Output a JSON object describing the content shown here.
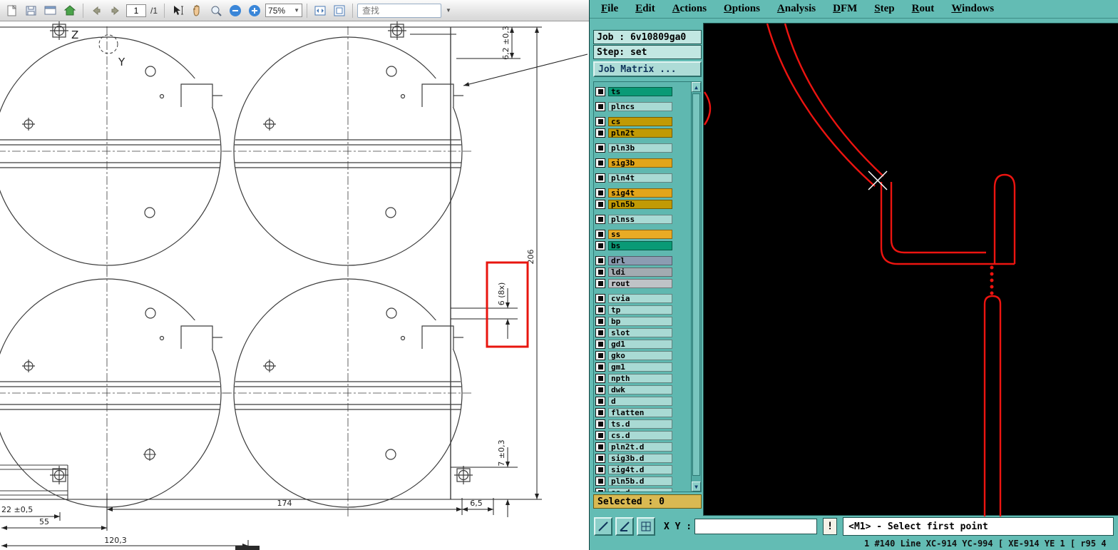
{
  "pdf": {
    "toolbar": {
      "page_current": "1",
      "page_total": "/1",
      "zoom_level": "75%",
      "search_placeholder": "查找"
    },
    "drawing": {
      "highlight_color": "#e8150e",
      "dims": {
        "label_z": "Z",
        "label_y": "Y",
        "gap_top": "6,2 ±0,3",
        "panel_height": "206",
        "tab_width": "6 (8x)",
        "gap_bottom": "7 ±0,3",
        "strip_height": "22 ±0,5",
        "strip_width": "55",
        "pitch": "174",
        "edge_gap": "6,5",
        "offset": "120,3"
      }
    }
  },
  "cam": {
    "menu": [
      "File",
      "Edit",
      "Actions",
      "Options",
      "Analysis",
      "DFM",
      "Step",
      "Rout",
      "Windows"
    ],
    "job_label": "Job : 6v10809ga0",
    "step_label": "Step: set",
    "job_matrix_label": "Job Matrix ...",
    "layers": [
      {
        "name": "ts",
        "color": "#0a9a76",
        "gap": false
      },
      {
        "name": "plncs",
        "color": "#a9dad4",
        "gap": true
      },
      {
        "name": "cs",
        "color": "#c19a04",
        "gap": true
      },
      {
        "name": "pln2t",
        "color": "#c19a04",
        "gap": false
      },
      {
        "name": "pln3b",
        "color": "#a9dad4",
        "gap": true
      },
      {
        "name": "sig3b",
        "color": "#e2a51a",
        "gap": true
      },
      {
        "name": "pln4t",
        "color": "#a9dad4",
        "gap": true
      },
      {
        "name": "sig4t",
        "color": "#e2a51a",
        "gap": true
      },
      {
        "name": "pln5b",
        "color": "#c19a04",
        "gap": false
      },
      {
        "name": "plnss",
        "color": "#a9dad4",
        "gap": true
      },
      {
        "name": "ss",
        "color": "#e9ab25",
        "gap": true
      },
      {
        "name": "bs",
        "color": "#0a9a76",
        "gap": false
      },
      {
        "name": "drl",
        "color": "#8c9cb2",
        "gap": true
      },
      {
        "name": "ldi",
        "color": "#a3abb1",
        "gap": false
      },
      {
        "name": "rout",
        "color": "#bfc3c7",
        "gap": false
      },
      {
        "name": "cvia",
        "color": "#a9dad4",
        "gap": true
      },
      {
        "name": "tp",
        "color": "#a9dad4",
        "gap": false
      },
      {
        "name": "bp",
        "color": "#a9dad4",
        "gap": false
      },
      {
        "name": "slot",
        "color": "#a9dad4",
        "gap": false
      },
      {
        "name": "gd1",
        "color": "#a9dad4",
        "gap": false
      },
      {
        "name": "gko",
        "color": "#a9dad4",
        "gap": false
      },
      {
        "name": "gm1",
        "color": "#a9dad4",
        "gap": false
      },
      {
        "name": "npth",
        "color": "#a9dad4",
        "gap": false
      },
      {
        "name": "dwk",
        "color": "#a9dad4",
        "gap": false
      },
      {
        "name": "d",
        "color": "#a9dad4",
        "gap": false
      },
      {
        "name": "flatten",
        "color": "#a9dad4",
        "gap": false
      },
      {
        "name": "ts.d",
        "color": "#a9dad4",
        "gap": false
      },
      {
        "name": "cs.d",
        "color": "#a9dad4",
        "gap": false
      },
      {
        "name": "pln2t.d",
        "color": "#a9dad4",
        "gap": false
      },
      {
        "name": "sig3b.d",
        "color": "#a9dad4",
        "gap": false
      },
      {
        "name": "sig4t.d",
        "color": "#a9dad4",
        "gap": false
      },
      {
        "name": "pln5b.d",
        "color": "#a9dad4",
        "gap": false
      },
      {
        "name": "ss.d",
        "color": "#a9dad4",
        "gap": false
      }
    ],
    "selected_label": "Selected : 0",
    "selected_bg": "#d9b952",
    "xy_label": "X Y :",
    "xy_value": "",
    "alert_button": "!",
    "prompt": "<M1> - Select first point",
    "status_line": "1 #140 Line XC-914 YC-994 [ XE-914 YE 1 [ r95 4",
    "canvas_trace_color": "#ec1410"
  }
}
